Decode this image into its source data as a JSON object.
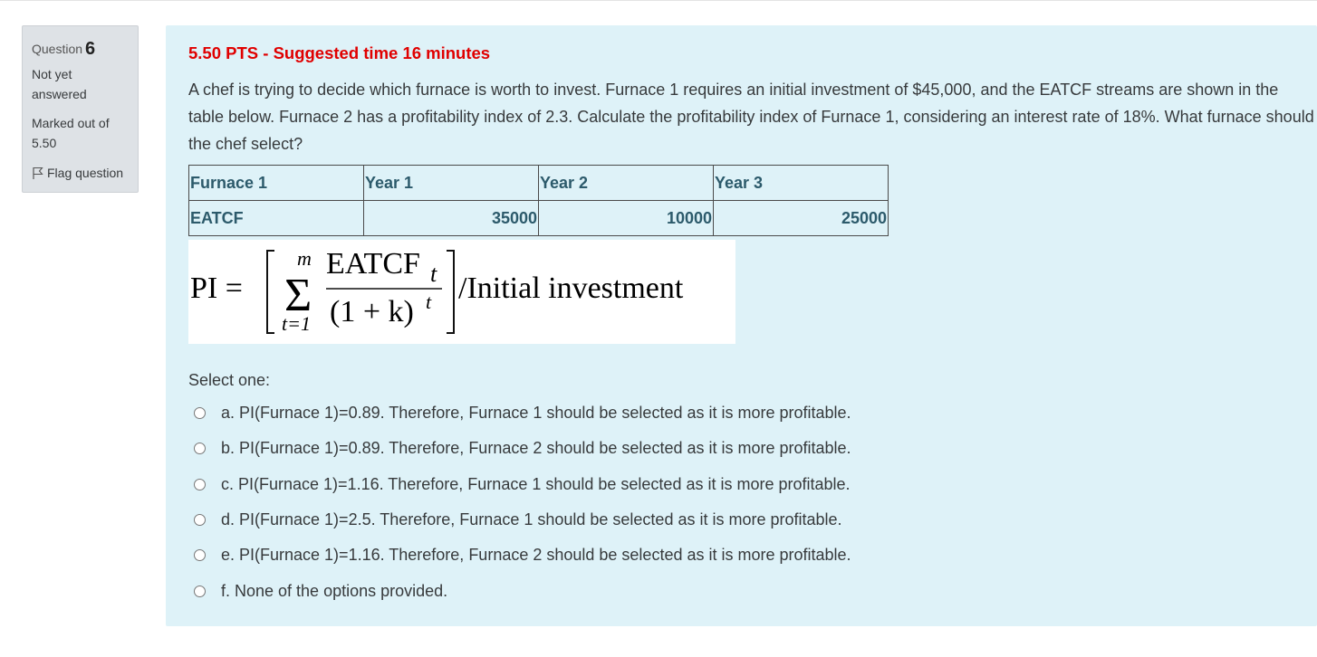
{
  "info": {
    "question_label": "Question",
    "question_number": "6",
    "state": "Not yet answered",
    "grade": "Marked out of 5.50",
    "flag_label": "Flag question"
  },
  "question": {
    "points_line": "5.50 PTS - Suggested time 16 minutes",
    "text": "A chef is trying to decide which furnace is worth to invest. Furnace 1 requires an initial investment of $45,000, and the EATCF streams are shown in the table below. Furnace 2 has a profitability index of 2.3. Calculate the profitability index of Furnace 1, considering an interest rate of 18%. What furnace should the chef select?",
    "table": {
      "headers": [
        "Furnace 1",
        "Year 1",
        "Year 2",
        "Year 3"
      ],
      "row": [
        "EATCF",
        "35000",
        "10000",
        "25000"
      ]
    },
    "formula": {
      "lhs": "PI =",
      "upper_limit": "m",
      "lower_limit": "t=1",
      "numerator": "EATCF",
      "numerator_sub": "t",
      "denominator": "(1 + k)",
      "denominator_sup": "t",
      "tail": "/Initial investment"
    },
    "select_label": "Select one:",
    "options": [
      "a. PI(Furnace 1)=0.89. Therefore, Furnace 1 should be selected as it is more profitable.",
      "b. PI(Furnace 1)=0.89. Therefore, Furnace 2 should be selected as it is more profitable.",
      "c. PI(Furnace 1)=1.16. Therefore, Furnace 1 should be selected as it is more profitable.",
      "d. PI(Furnace 1)=2.5. Therefore, Furnace 1 should be selected as it is more profitable.",
      "e. PI(Furnace 1)=1.16. Therefore, Furnace 2 should be selected as it is more profitable.",
      "f. None of the options provided."
    ]
  }
}
